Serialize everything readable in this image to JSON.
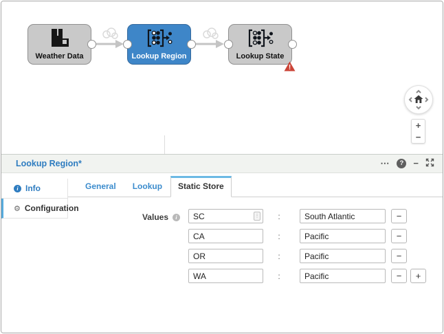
{
  "pipeline": {
    "nodes": [
      {
        "label": "Weather Data",
        "state": "default"
      },
      {
        "label": "Lookup Region",
        "state": "selected"
      },
      {
        "label": "Lookup State",
        "state": "error"
      }
    ],
    "error_badge": "!"
  },
  "canvas_controls": {
    "zoom_in": "+",
    "zoom_out": "−"
  },
  "panel": {
    "title": "Lookup Region*",
    "header_icons": {
      "more": "⋯",
      "help": "?",
      "minimize": "−"
    },
    "sidebar": {
      "items": [
        {
          "label": "Info"
        },
        {
          "label": "Configuration"
        }
      ]
    },
    "tabs": [
      {
        "label": "General"
      },
      {
        "label": "Lookup"
      },
      {
        "label": "Static Store"
      }
    ],
    "form": {
      "label": "Values",
      "separator": ":",
      "remove_label": "−",
      "add_label": "+",
      "rows": [
        {
          "key": "SC",
          "value": "South Atlantic"
        },
        {
          "key": "CA",
          "value": "Pacific"
        },
        {
          "key": "OR",
          "value": "Pacific"
        },
        {
          "key": "WA",
          "value": "Pacific"
        }
      ]
    }
  },
  "colors": {
    "node_selected": "#3e86c8",
    "node_default": "#c9c9c9",
    "title_blue": "#2e7cc0",
    "tab_active_accent": "#6cb9e4",
    "error_red": "#cb4437"
  }
}
